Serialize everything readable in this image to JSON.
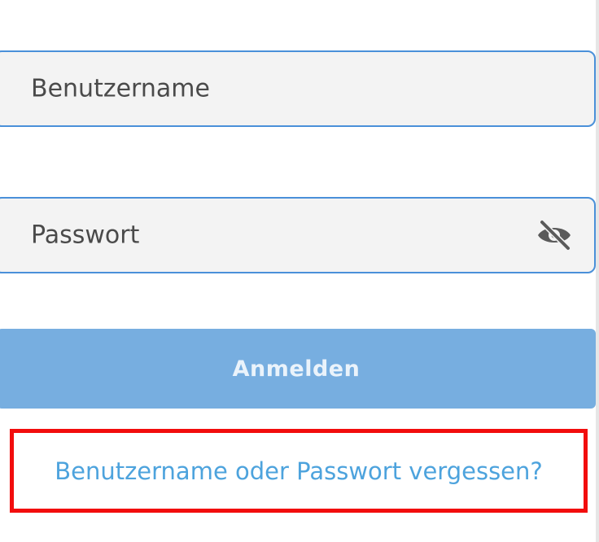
{
  "login_form": {
    "username_placeholder": "Benutzername",
    "password_placeholder": "Passwort",
    "password_toggle_icon": "eye-off-icon",
    "submit_label": "Anmelden",
    "forgot_link_label": "Benutzername oder Passwort vergessen?"
  },
  "colors": {
    "field_background": "#f3f3f3",
    "field_border": "#4a90d9",
    "button_background": "#77aee0",
    "link": "#4da3dd",
    "highlight_border": "#f20d0d"
  }
}
